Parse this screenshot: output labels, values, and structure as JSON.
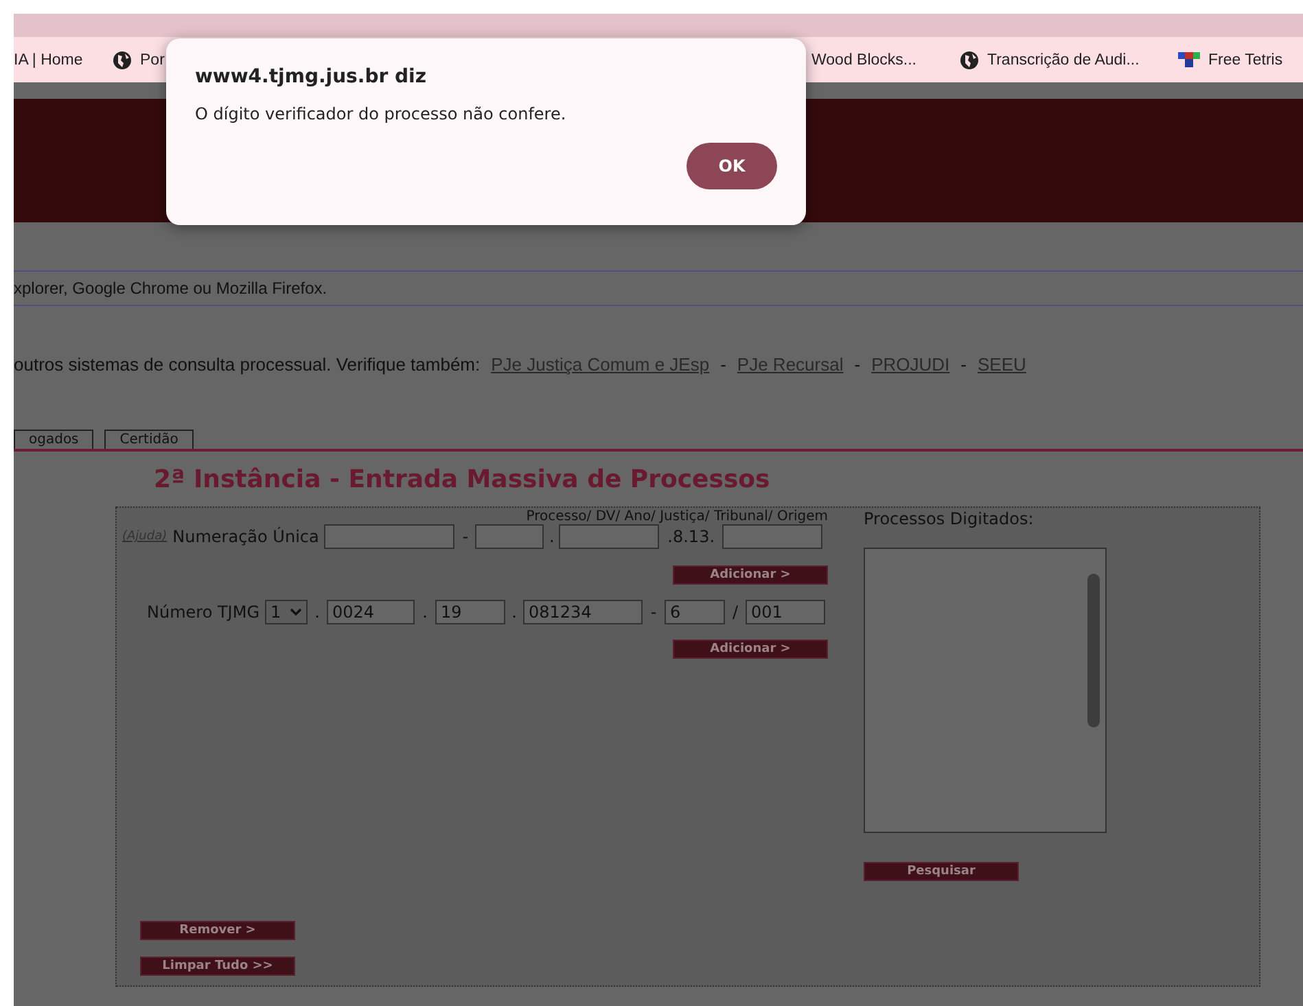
{
  "browser": {
    "bookmarks": [
      {
        "label": "IA | Home"
      },
      {
        "label": "Por"
      },
      {
        "label": "Wood Blocks..."
      },
      {
        "label": "Transcrição de Audi..."
      },
      {
        "label": "Free Tetris"
      }
    ]
  },
  "dialog": {
    "title": "www4.tjmg.jus.br diz",
    "message": "O dígito verificador do processo não confere.",
    "button": "OK"
  },
  "notice": "xplorer, Google Chrome ou Mozilla Firefox.",
  "systems": {
    "text": "outros sistemas de consulta processual. Verifique também:",
    "items": [
      {
        "kind": "link",
        "text": "PJe Justiça Comum e JEsp"
      },
      {
        "kind": "sep",
        "text": "-"
      },
      {
        "kind": "link",
        "text": "PJe Recursal"
      },
      {
        "kind": "sep",
        "text": "-"
      },
      {
        "kind": "link",
        "text": "PROJUDI"
      },
      {
        "kind": "sep",
        "text": "-"
      },
      {
        "kind": "link",
        "text": "SEEU"
      }
    ]
  },
  "tabs": [
    {
      "label": "ogados",
      "selected": false
    },
    {
      "label": "Certidão",
      "selected": false
    }
  ],
  "form": {
    "title": "2ª Instância - Entrada Massiva de Processos",
    "unica": {
      "help": "(Ajuda)",
      "label": "Numeração Única",
      "hint": "Processo/ DV/ Ano/ Justiça/ Tribunal/ Origem",
      "parts": [
        {
          "kind": "input"
        },
        {
          "kind": "sep",
          "text": "-"
        },
        {
          "kind": "input"
        },
        {
          "kind": "sep",
          "text": "."
        },
        {
          "kind": "input"
        },
        {
          "kind": "sep",
          "text": ".8.13."
        },
        {
          "kind": "input"
        }
      ],
      "button": "Adicionar >"
    },
    "tjmg": {
      "label": "Número TJMG",
      "parts": [
        {
          "kind": "select",
          "value": "1"
        },
        {
          "kind": "sep",
          "text": "."
        },
        {
          "kind": "input",
          "value": "0024"
        },
        {
          "kind": "sep",
          "text": "."
        },
        {
          "kind": "input",
          "value": "19"
        },
        {
          "kind": "sep",
          "text": "."
        },
        {
          "kind": "input",
          "value": "081234"
        },
        {
          "kind": "sep",
          "text": "-"
        },
        {
          "kind": "input",
          "value": "6"
        },
        {
          "kind": "sep",
          "text": "/"
        },
        {
          "kind": "input",
          "value": "001"
        }
      ],
      "button": "Adicionar >"
    },
    "digitados": {
      "label": "Processos Digitados:",
      "button": "Pesquisar"
    },
    "actions": [
      "Remover >",
      "Limpar Tudo >>"
    ]
  }
}
